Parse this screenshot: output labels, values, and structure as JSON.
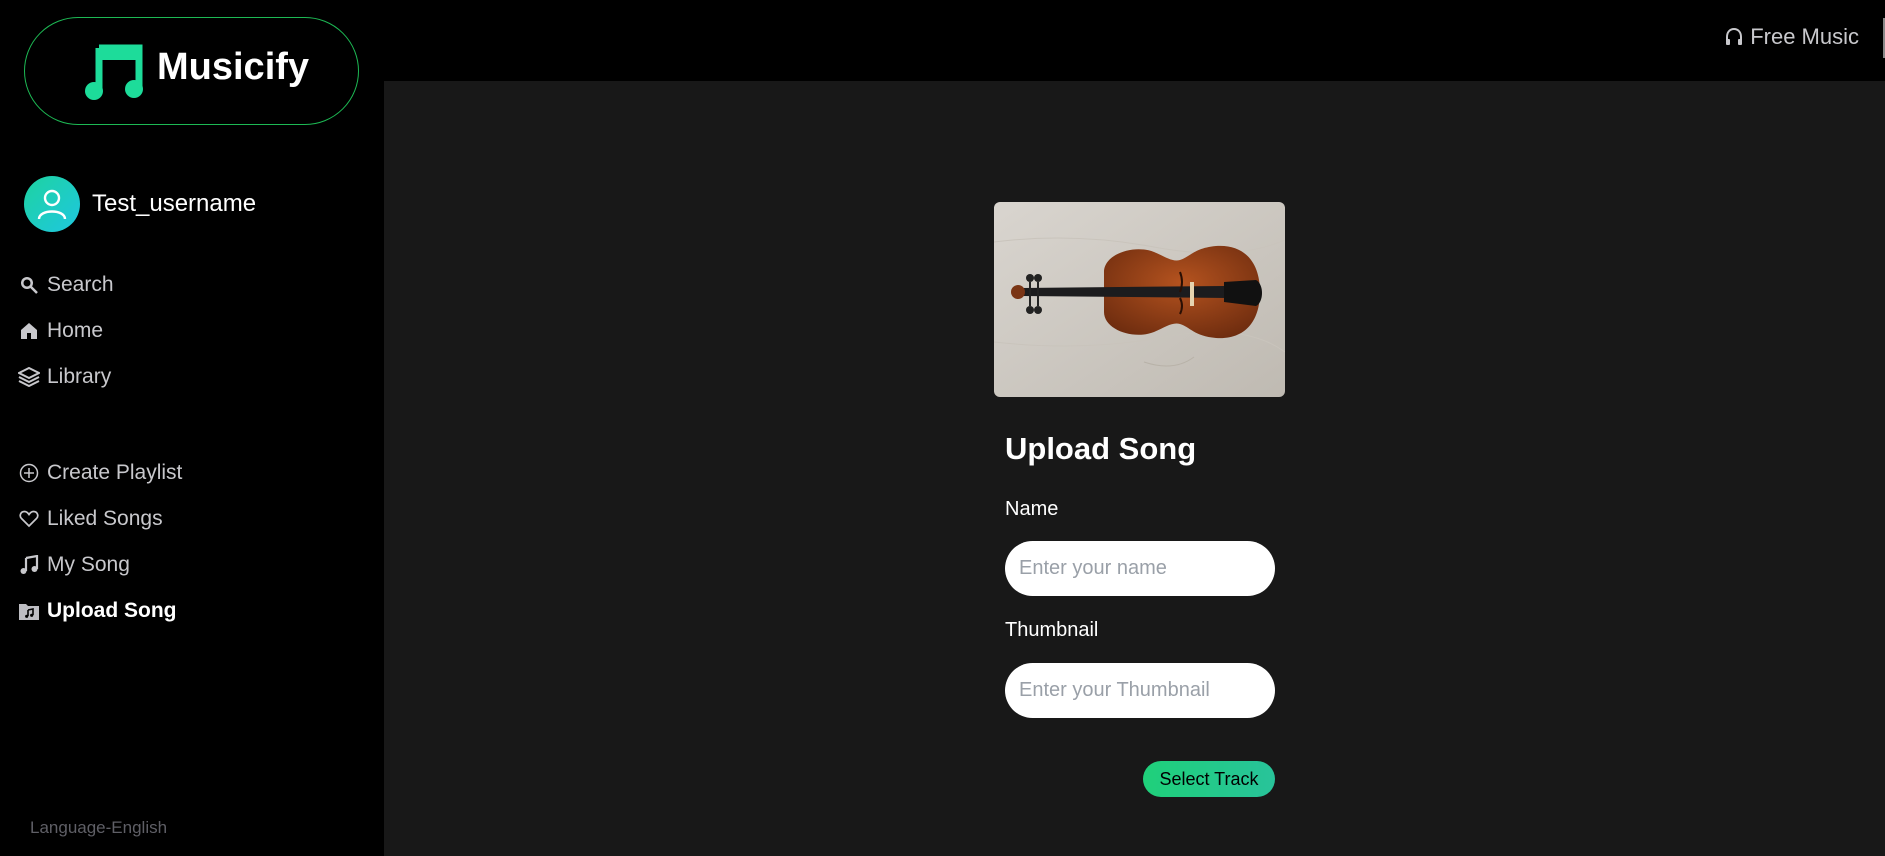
{
  "brand": {
    "name": "Musicify"
  },
  "user": {
    "username": "Test_username"
  },
  "sidebar": {
    "primary": [
      {
        "label": "Search",
        "icon": "search-icon"
      },
      {
        "label": "Home",
        "icon": "home-icon"
      },
      {
        "label": "Library",
        "icon": "layers-icon"
      }
    ],
    "secondary": [
      {
        "label": "Create Playlist",
        "icon": "plus-circle-icon"
      },
      {
        "label": "Liked Songs",
        "icon": "heart-icon"
      },
      {
        "label": "My Song",
        "icon": "music-note-icon"
      },
      {
        "label": "Upload Song",
        "icon": "music-folder-icon",
        "active": true
      }
    ],
    "language": "Language-English"
  },
  "header": {
    "free_music": "Free Music"
  },
  "upload": {
    "title": "Upload Song",
    "name_label": "Name",
    "name_placeholder": "Enter your name",
    "thumbnail_label": "Thumbnail",
    "thumbnail_placeholder": "Enter your Thumbnail",
    "select_track": "Select Track"
  },
  "colors": {
    "accent": "#1db954",
    "background": "#000000",
    "panel": "#181818"
  }
}
